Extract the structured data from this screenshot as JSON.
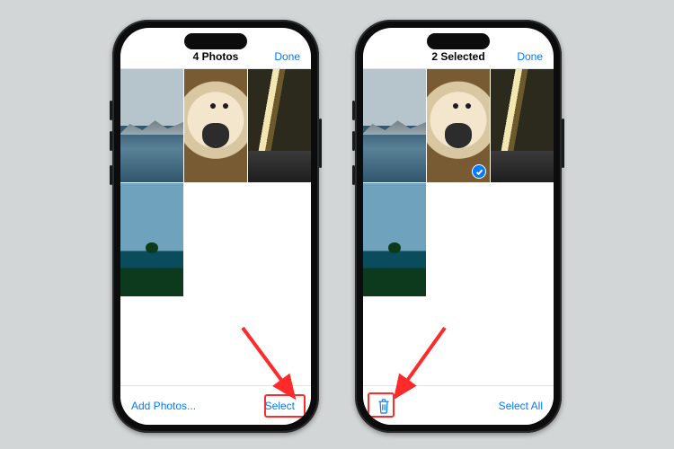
{
  "phones": {
    "left": {
      "header": {
        "title": "4 Photos",
        "done": "Done"
      },
      "footer": {
        "left_label": "Add Photos...",
        "right_label": "Select"
      },
      "thumbs": [
        "mountains",
        "dog",
        "road",
        "island"
      ]
    },
    "right": {
      "header": {
        "title": "2 Selected",
        "done": "Done"
      },
      "footer": {
        "right_label": "Select All",
        "trash_icon": "trash-icon"
      },
      "thumbs": [
        "mountains",
        "dog",
        "road",
        "island"
      ],
      "selected_indices": [
        1,
        2
      ]
    }
  },
  "colors": {
    "ios_blue": "#007aff",
    "highlight_red": "#ff2a2a"
  },
  "annotations": {
    "left_highlight_target": "select-button",
    "right_highlight_target": "trash-button"
  }
}
